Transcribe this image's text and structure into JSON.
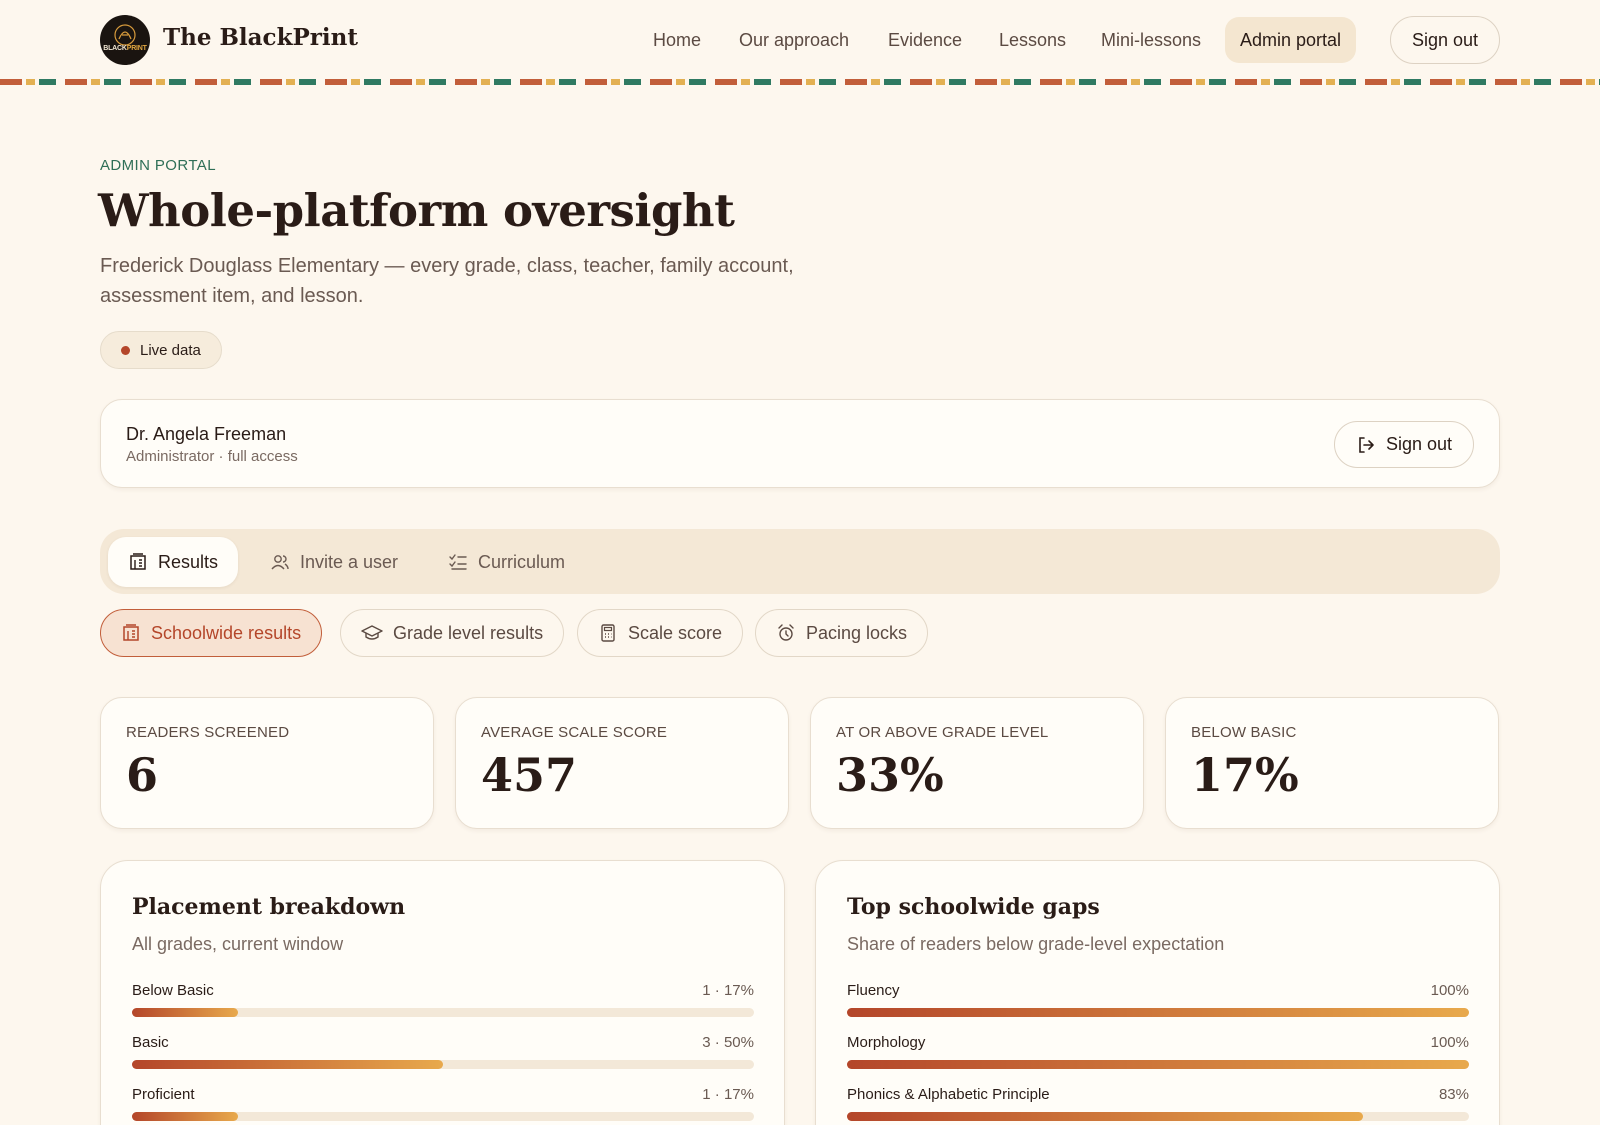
{
  "header": {
    "brand": "The BlackPrint",
    "logo_text_a": "BLACK",
    "logo_text_b": "PRINT",
    "nav": [
      "Home",
      "Our approach",
      "Evidence",
      "Lessons",
      "Mini-lessons",
      "Admin portal"
    ],
    "active_nav": "Admin portal",
    "signout": "Sign out"
  },
  "hero": {
    "eyebrow": "ADMIN PORTAL",
    "title": "Whole-platform oversight",
    "subtitle": "Frederick Douglass Elementary — every grade, class, teacher, family account, assessment item, and lesson.",
    "live": "Live data"
  },
  "user": {
    "name": "Dr. Angela Freeman",
    "role": "Administrator · full access",
    "signout": "Sign out"
  },
  "tabs": [
    "Results",
    "Invite a user",
    "Curriculum"
  ],
  "active_tab": "Results",
  "subtabs": [
    "Schoolwide results",
    "Grade level results",
    "Scale score",
    "Pacing locks"
  ],
  "active_subtab": "Schoolwide results",
  "stats": [
    {
      "label": "READERS SCREENED",
      "value": "6"
    },
    {
      "label": "AVERAGE SCALE SCORE",
      "value": "457"
    },
    {
      "label": "AT OR ABOVE GRADE LEVEL",
      "value": "33%"
    },
    {
      "label": "BELOW BASIC",
      "value": "17%"
    }
  ],
  "placement": {
    "title": "Placement breakdown",
    "subtitle": "All grades, current window",
    "rows": [
      {
        "label": "Below Basic",
        "value": "1 · 17%",
        "percent": 17
      },
      {
        "label": "Basic",
        "value": "3 · 50%",
        "percent": 50
      },
      {
        "label": "Proficient",
        "value": "1 · 17%",
        "percent": 17
      }
    ]
  },
  "gaps": {
    "title": "Top schoolwide gaps",
    "subtitle": "Share of readers below grade-level expectation",
    "rows": [
      {
        "label": "Fluency",
        "value": "100%",
        "percent": 100
      },
      {
        "label": "Morphology",
        "value": "100%",
        "percent": 100
      },
      {
        "label": "Phonics & Alphabetic Principle",
        "value": "83%",
        "percent": 83
      }
    ]
  },
  "colors": {
    "accent": "#b4462a",
    "accent_green": "#2f6f57",
    "gold": "#e8a94c",
    "background": "#fdf7ee"
  }
}
